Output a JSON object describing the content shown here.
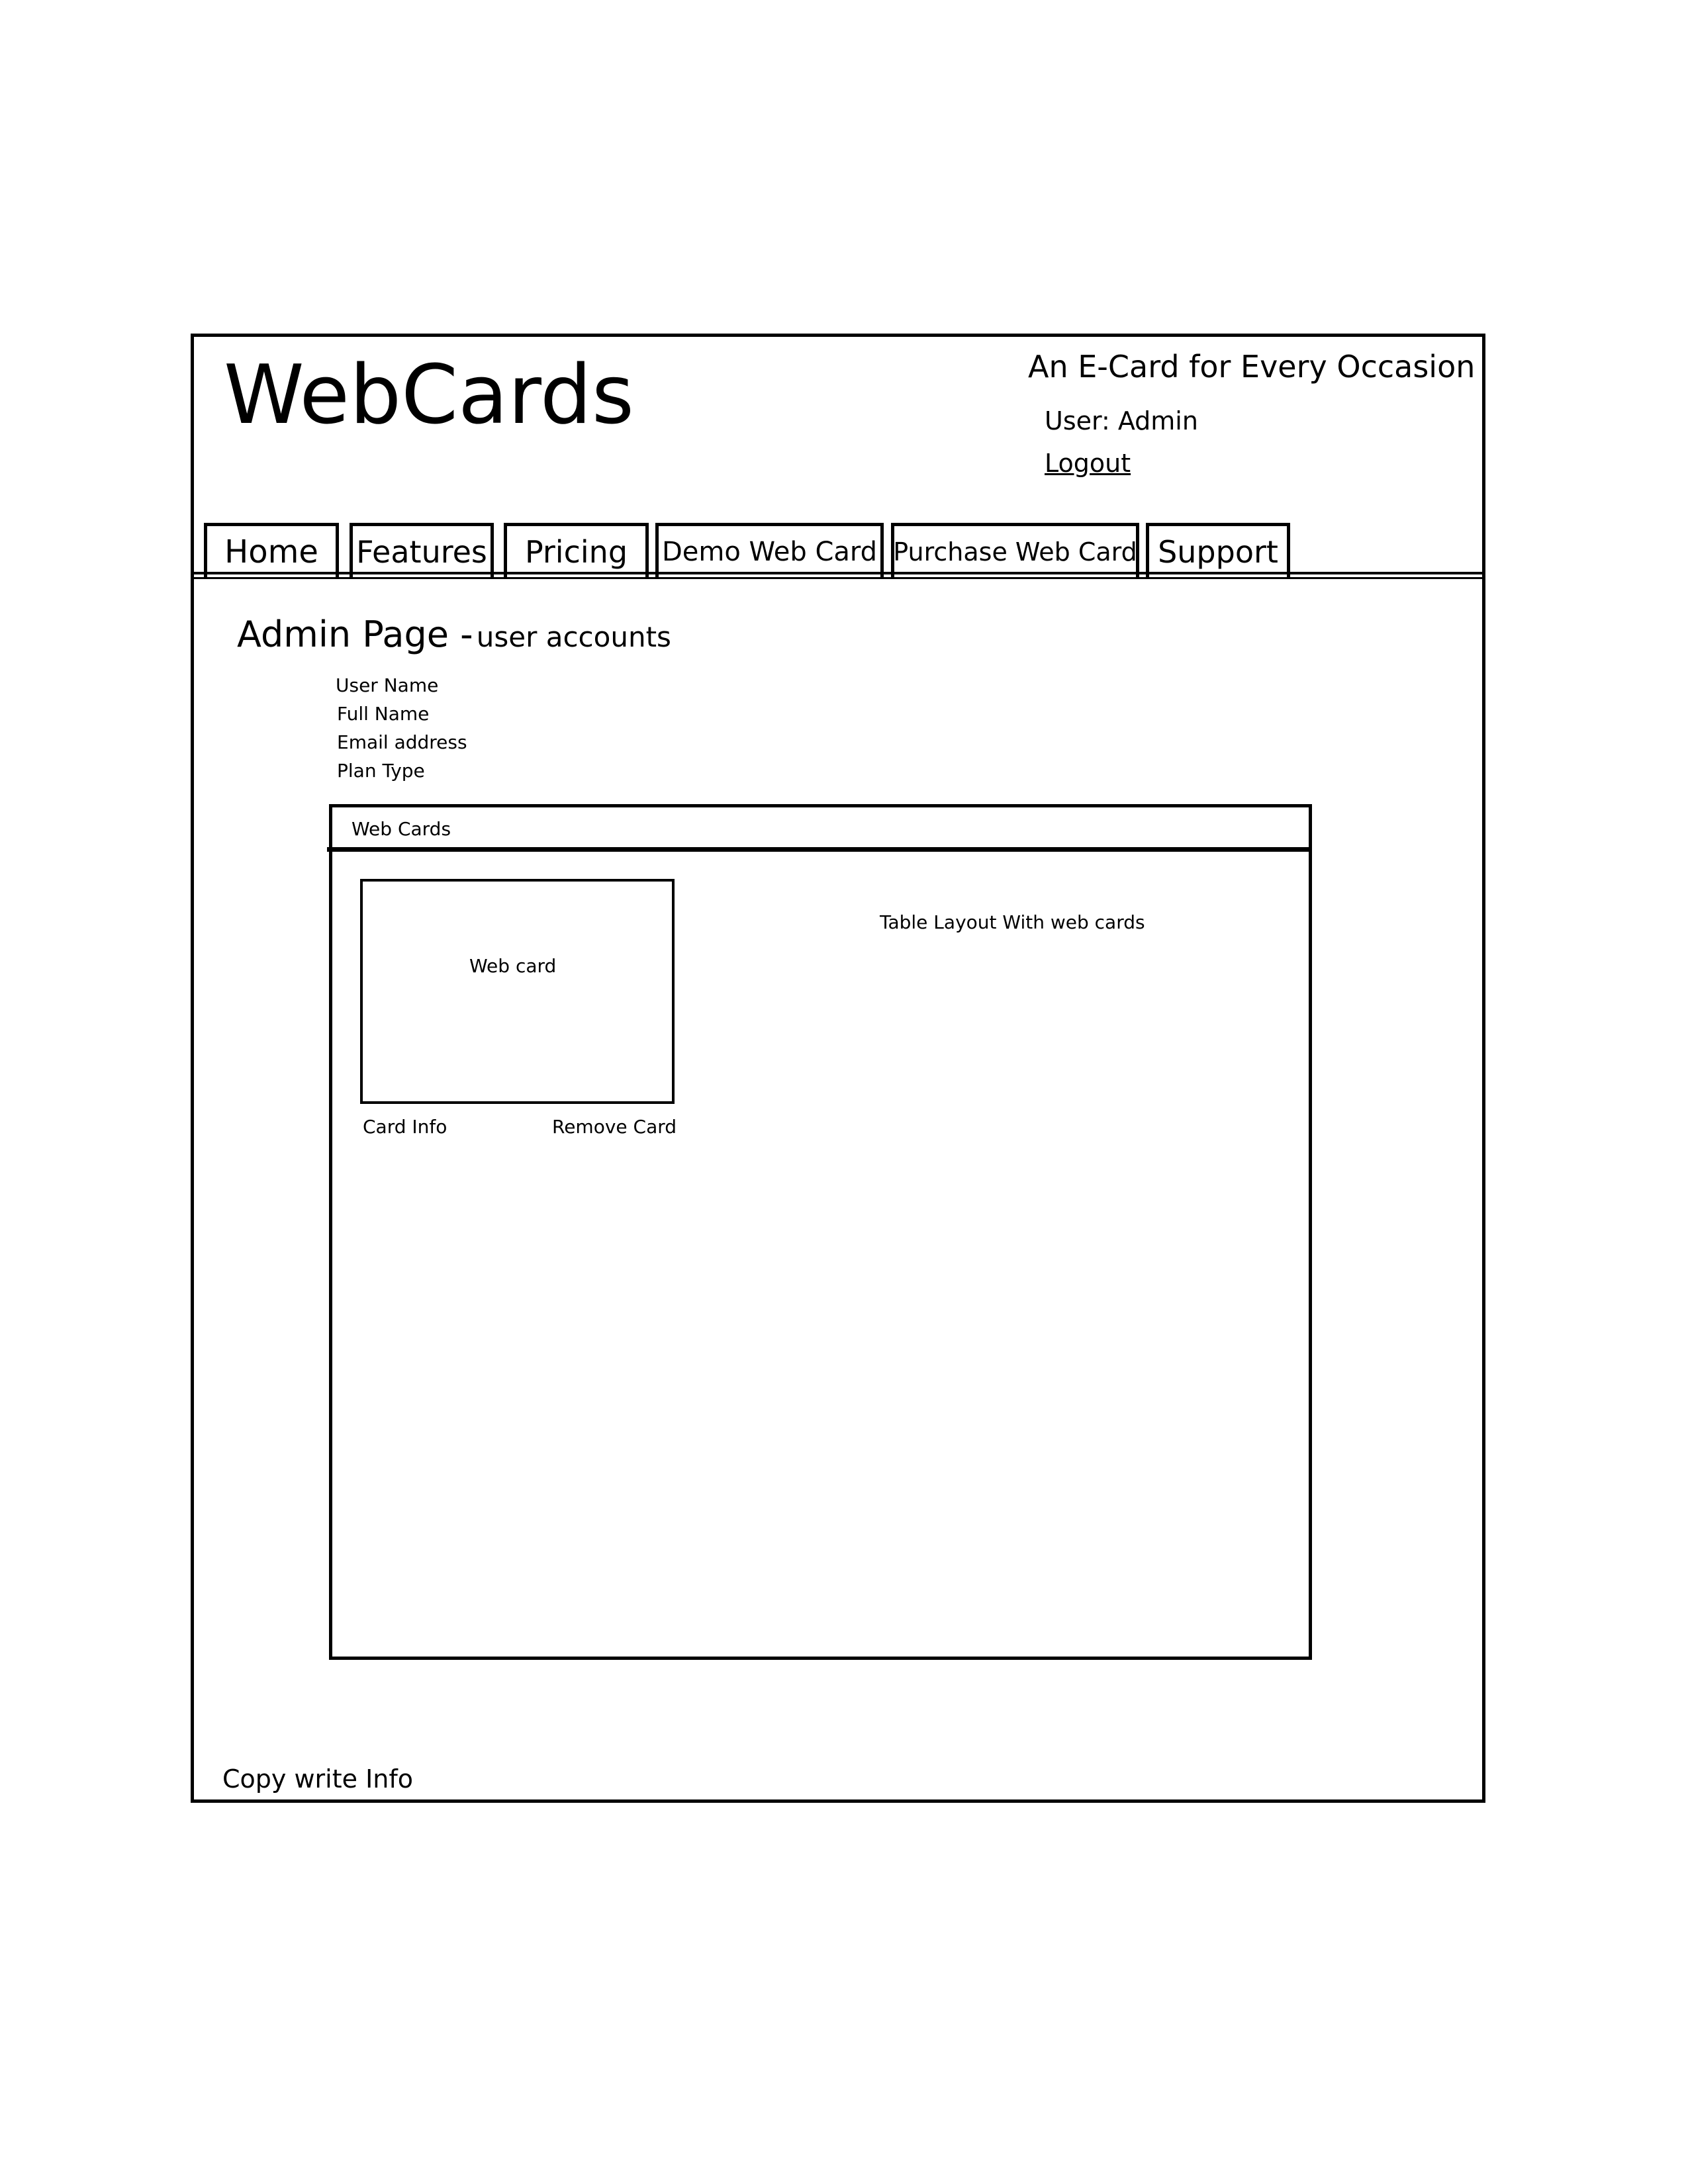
{
  "header": {
    "logo": "WebCards",
    "tagline": "An E-Card for Every Occasion",
    "user_prefix": "User:",
    "user_name": "Admin",
    "logout_label": "Logout"
  },
  "nav": {
    "tabs": [
      {
        "label": "Home"
      },
      {
        "label": "Features"
      },
      {
        "label": "Pricing"
      },
      {
        "label": "Demo Web Card"
      },
      {
        "label": "Purchase Web Card"
      },
      {
        "label": "Support"
      }
    ]
  },
  "main": {
    "title": "Admin Page -",
    "subtitle": "user accounts",
    "fields": [
      "User Name",
      "Full Name",
      "Email address",
      "Plan Type"
    ],
    "panel": {
      "title": "Web Cards",
      "note": "Table Layout With web cards",
      "card": {
        "label": "Web card",
        "info_link": "Card Info",
        "remove_link": "Remove Card"
      }
    }
  },
  "footer": {
    "text": "Copy write Info"
  }
}
